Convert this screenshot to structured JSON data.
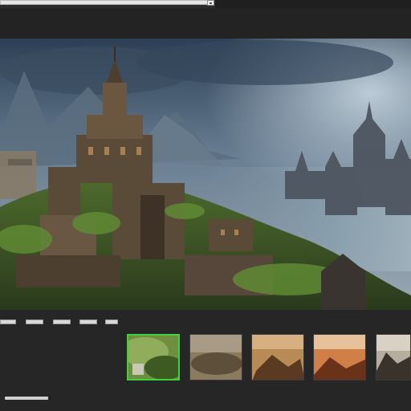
{
  "top_bar": {
    "address_value": ""
  },
  "preview": {
    "alt": ""
  },
  "tabs": [
    {
      "label": ""
    },
    {
      "label": ""
    },
    {
      "label": ""
    },
    {
      "label": ""
    },
    {
      "label": ""
    }
  ],
  "gallery": {
    "selected_index": 0,
    "thumbnails": [
      {
        "name": "thumbnail-1"
      },
      {
        "name": "thumbnail-2"
      },
      {
        "name": "thumbnail-3"
      },
      {
        "name": "thumbnail-4"
      },
      {
        "name": "thumbnail-5"
      }
    ]
  },
  "status": {
    "text": ""
  },
  "colors": {
    "accent": "#3fd13f",
    "panel": "#232323",
    "chrome": "#e6e6e6"
  }
}
